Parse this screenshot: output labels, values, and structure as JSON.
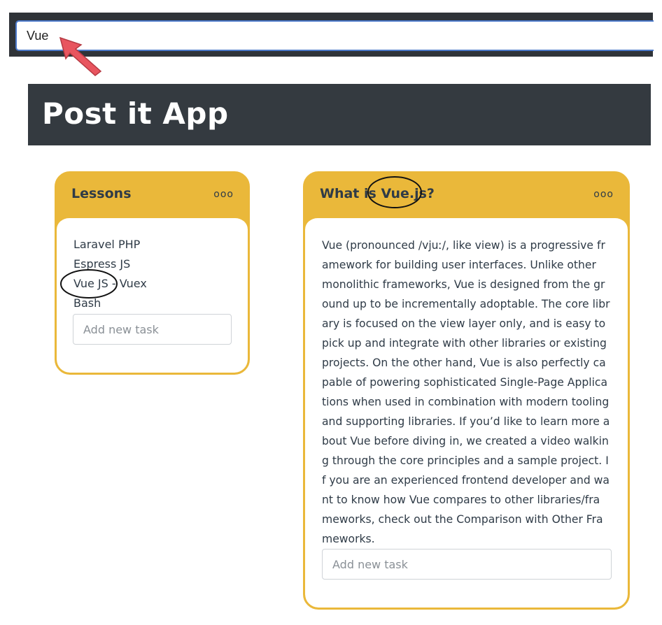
{
  "search": {
    "value": "Vue",
    "placeholder": ""
  },
  "header": {
    "title": "Post it App"
  },
  "cards": [
    {
      "title": "Lessons",
      "menu": "ooo",
      "tasks": [
        "Laravel PHP",
        "Espress JS",
        "Vue JS - Vuex",
        "Bash"
      ],
      "add_placeholder": "Add new task"
    },
    {
      "title": "What is Vue.js?",
      "menu": "ooo",
      "description": "Vue (pronounced /vjuː/, like view) is a progressive framework for building user interfaces. Unlike other monolithic frameworks, Vue is designed from the ground up to be incrementally adoptable. The core library is focused on the view layer only, and is easy to pick up and integrate with other libraries or existing projects. On the other hand, Vue is also perfectly capable of powering sophisticated Single-Page Applications when used in combination with modern tooling and supporting libraries. If you’d like to learn more about Vue before diving in, we created a video walking through the core principles and a sample project. If you are an experienced frontend developer and want to know how Vue compares to other libraries/frameworks, check out the Comparison with Other Frameworks.",
      "add_placeholder": "Add new task"
    }
  ],
  "colors": {
    "accent": "#eab83a",
    "header_bg": "#343a40",
    "search_border": "#4a78c9",
    "arrow": "#e8555f"
  },
  "icons": {
    "pointer": "arrow-pointer-icon",
    "menu": "more-dots-icon"
  }
}
